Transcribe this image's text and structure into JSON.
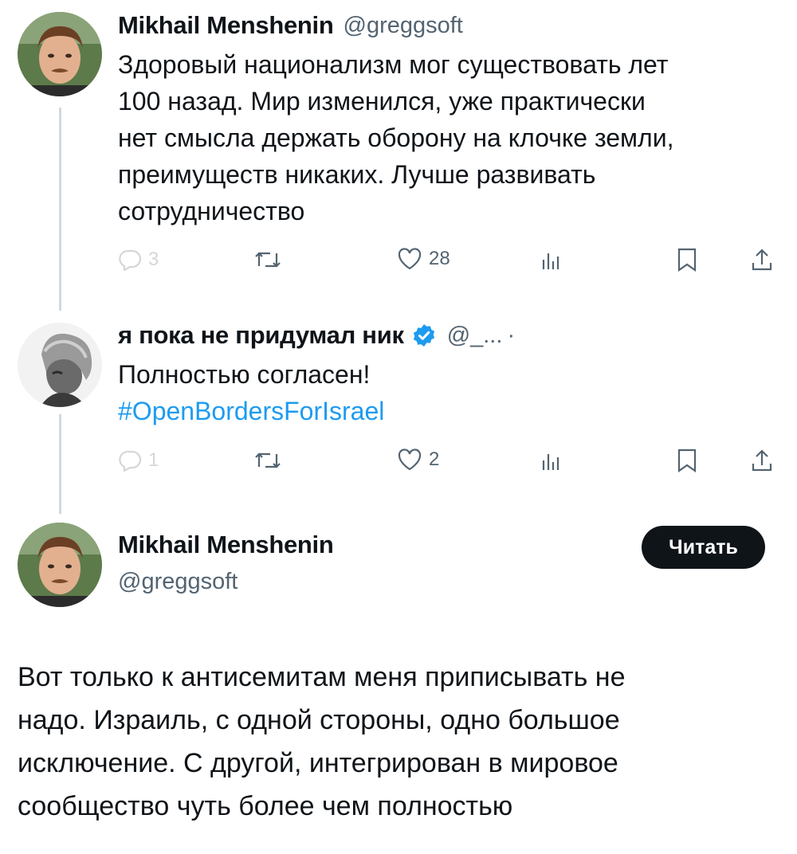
{
  "tweets": [
    {
      "author_name": "Mikhail Menshenin",
      "handle": "@greggsoft",
      "text_lines": [
        "Здоровый национализм мог существовать лет",
        "100 назад. Мир изменился,  уже практически",
        "нет смысла держать оборону на клочке земли,",
        "преимуществ никаких. Лучше развивать",
        "сотрудничество"
      ],
      "actions": {
        "replies": "3",
        "likes": "28"
      }
    },
    {
      "author_name": "я пока не придумал ник",
      "handle": "@_...",
      "separator": "·",
      "text": "Полностью согласен!",
      "hashtag": "#OpenBordersForIsrael",
      "actions": {
        "replies": "1",
        "likes": "2"
      }
    },
    {
      "author_name": "Mikhail Menshenin",
      "handle": "@greggsoft",
      "follow_label": "Читать",
      "text_lines": [
        "Вот только к антисемитам меня приписывать не",
        "надо. Израиль, с одной стороны, одно большое",
        "исключение. С другой, интегрирован в мировое",
        "сообщество чуть более чем полностью"
      ]
    }
  ],
  "icons": {
    "reply": "reply-icon",
    "retweet": "retweet-icon",
    "like": "heart-icon",
    "views": "views-icon",
    "bookmark": "bookmark-icon",
    "share": "share-icon",
    "verified": "verified-badge-icon"
  },
  "colors": {
    "text": "#0f1419",
    "secondary": "#536471",
    "link": "#1d9bf0",
    "verified": "#1d9bf0",
    "button": "#0f1419"
  }
}
